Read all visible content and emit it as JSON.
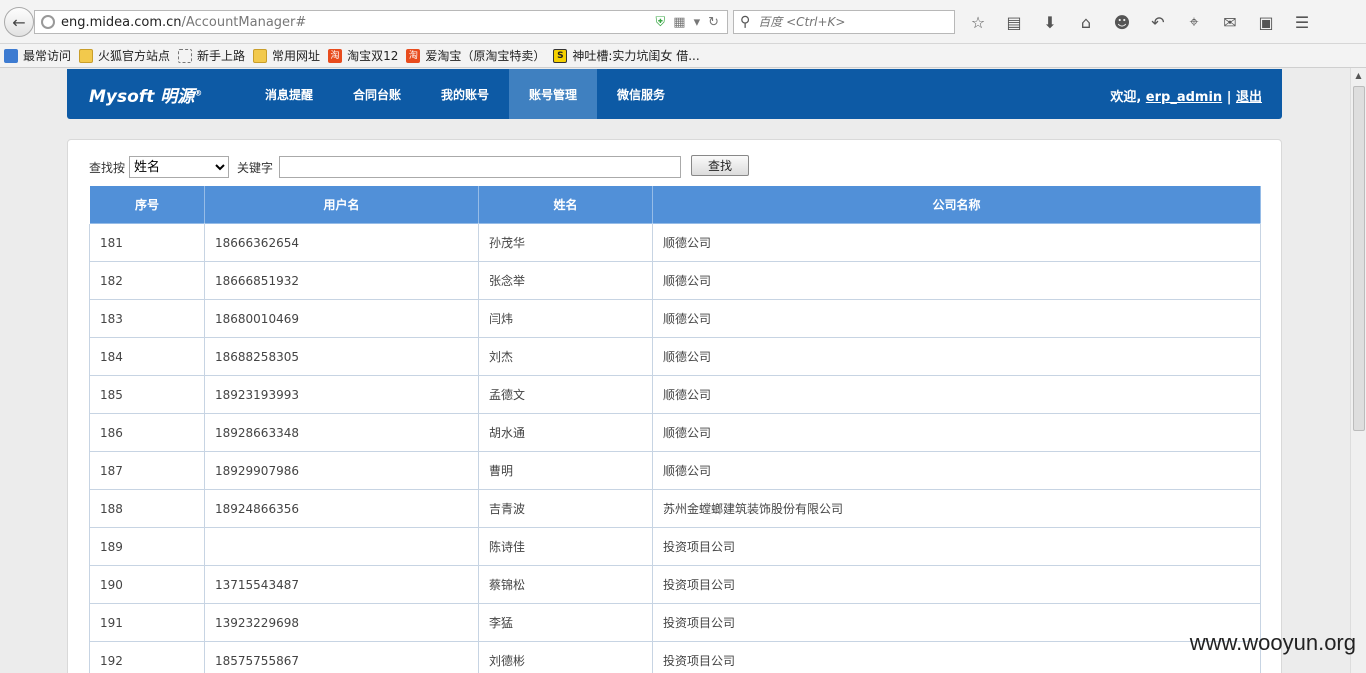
{
  "browser": {
    "url_domain": "eng.midea.com.cn",
    "url_path": "/AccountManager#",
    "search_placeholder": "百度 <Ctrl+K>"
  },
  "bookmarks": [
    {
      "label": "最常访问",
      "icon": "blue"
    },
    {
      "label": "火狐官方站点",
      "icon": "fold"
    },
    {
      "label": "新手上路",
      "icon": "dash"
    },
    {
      "label": "常用网址",
      "icon": "fold"
    },
    {
      "label": "淘宝双12",
      "icon": "tao"
    },
    {
      "label": "爱淘宝（原淘宝特卖）",
      "icon": "tao"
    },
    {
      "label": "神吐槽:实力坑闺女 借...",
      "icon": "sy"
    }
  ],
  "header": {
    "logo": "Mysoft 明源",
    "nav": [
      "消息提醒",
      "合同台账",
      "我的账号",
      "账号管理",
      "微信服务"
    ],
    "active_nav": 3,
    "welcome": "欢迎,",
    "username": "erp_admin",
    "separator": "|",
    "logout": "退出"
  },
  "search": {
    "label": "查找按",
    "selected": "姓名",
    "keyword_label": "关键字",
    "keyword_value": "",
    "button": "查找"
  },
  "table": {
    "headers": [
      "序号",
      "用户名",
      "姓名",
      "公司名称"
    ],
    "rows": [
      [
        "181",
        "18666362654",
        "孙茂华",
        "顺德公司"
      ],
      [
        "182",
        "18666851932",
        "张念举",
        "顺德公司"
      ],
      [
        "183",
        "18680010469",
        "闫炜",
        "顺德公司"
      ],
      [
        "184",
        "18688258305",
        "刘杰",
        "顺德公司"
      ],
      [
        "185",
        "18923193993",
        "孟德文",
        "顺德公司"
      ],
      [
        "186",
        "18928663348",
        "胡水通",
        "顺德公司"
      ],
      [
        "187",
        "18929907986",
        "曹明",
        "顺德公司"
      ],
      [
        "188",
        "18924866356",
        "吉青波",
        "苏州金螳螂建筑装饰股份有限公司"
      ],
      [
        "189",
        "",
        "陈诗佳",
        "投资项目公司"
      ],
      [
        "190",
        "13715543487",
        "蔡锦松",
        "投资项目公司"
      ],
      [
        "191",
        "13923229698",
        "李猛",
        "投资项目公司"
      ],
      [
        "192",
        "18575755867",
        "刘德彬",
        "投资项目公司"
      ]
    ]
  },
  "watermark": "www.wooyun.org"
}
